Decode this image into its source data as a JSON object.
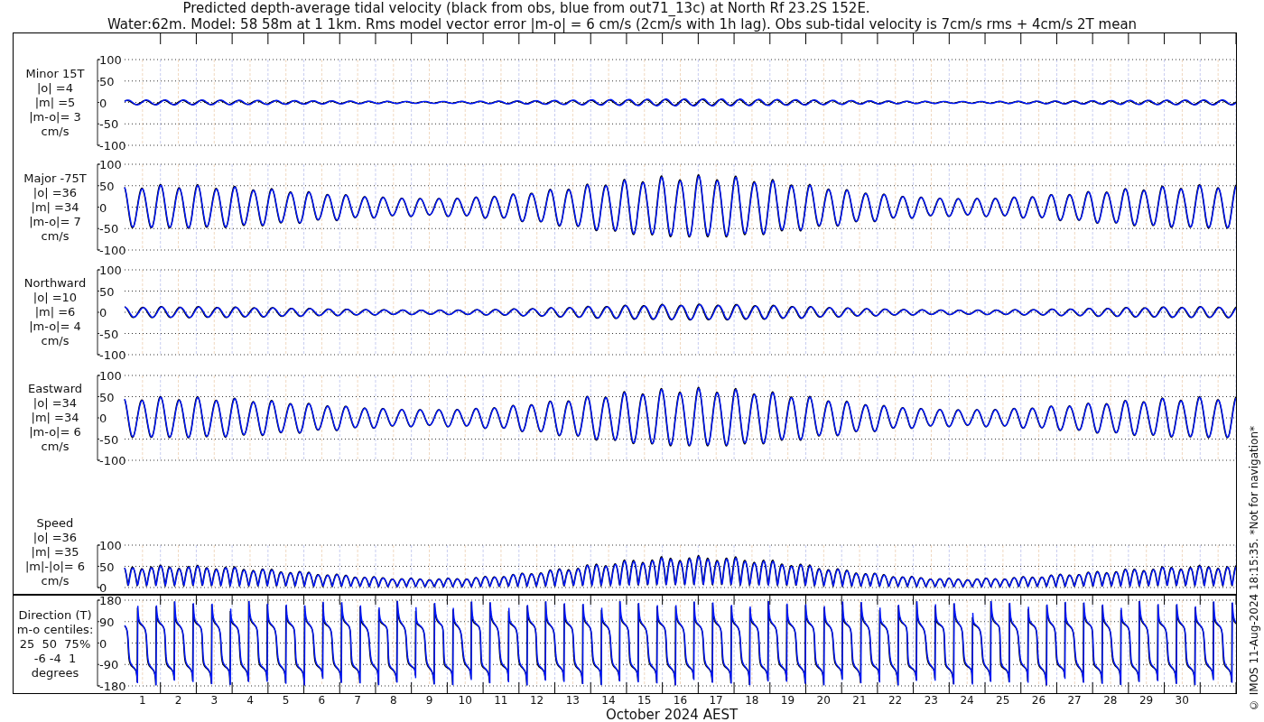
{
  "title_lines": [
    "Predicted depth-average tidal velocity (black from obs, blue from out71_13c) at North Rf 23.2S 152E.",
    "Water:62m. Model: 58 58m at 1 1km. Rms model vector error |m-o| = 6 cm/s (2cm/s with 1h lag). Obs sub-tidal velocity is 7cm/s rms + 4cm/s 2T mean"
  ],
  "panels": [
    {
      "kind": "minor",
      "label_lines": [
        "Minor 15T",
        "|o| =4",
        "|m| =5",
        "|m-o|= 3",
        "cm/s"
      ],
      "yticks": [
        "100",
        "50",
        "0",
        "-50",
        "-100"
      ]
    },
    {
      "kind": "major",
      "label_lines": [
        "Major -75T",
        "|o| =36",
        "|m| =34",
        "|m-o|= 7",
        "cm/s"
      ],
      "yticks": [
        "100",
        "50",
        "0",
        "-50",
        "-100"
      ]
    },
    {
      "kind": "northward",
      "label_lines": [
        "Northward",
        "|o| =10",
        "|m| =6",
        "|m-o|= 4",
        "cm/s"
      ],
      "yticks": [
        "100",
        "50",
        "0",
        "-50",
        "-100"
      ]
    },
    {
      "kind": "eastward",
      "label_lines": [
        "Eastward",
        "|o| =34",
        "|m| =34",
        "|m-o|= 6",
        "cm/s"
      ],
      "yticks": [
        "100",
        "50",
        "0",
        "-50",
        "-100"
      ]
    },
    {
      "kind": "speed",
      "label_lines": [
        "Speed",
        "|o| =36",
        "|m| =35",
        "|m|-|o|= 6",
        "cm/s"
      ],
      "yticks": [
        "100",
        "50",
        "0"
      ]
    },
    {
      "kind": "direction",
      "label_lines": [
        "Direction (T)",
        "m-o centiles:",
        "25  50  75%",
        "-6 -4  1",
        "degrees"
      ],
      "yticks": [
        "180",
        "90",
        "0",
        "-90",
        "-180"
      ]
    }
  ],
  "x_tick_labels": [
    "1",
    "2",
    "3",
    "4",
    "5",
    "6",
    "7",
    "8",
    "9",
    "10",
    "11",
    "12",
    "13",
    "14",
    "15",
    "16",
    "17",
    "18",
    "19",
    "20",
    "21",
    "22",
    "23",
    "24",
    "25",
    "26",
    "27",
    "28",
    "29",
    "30"
  ],
  "xlabel": "October 2024 AEST",
  "side_note": "© IMOS 11-Aug-2024 18:15:35. *Not for navigation*"
}
